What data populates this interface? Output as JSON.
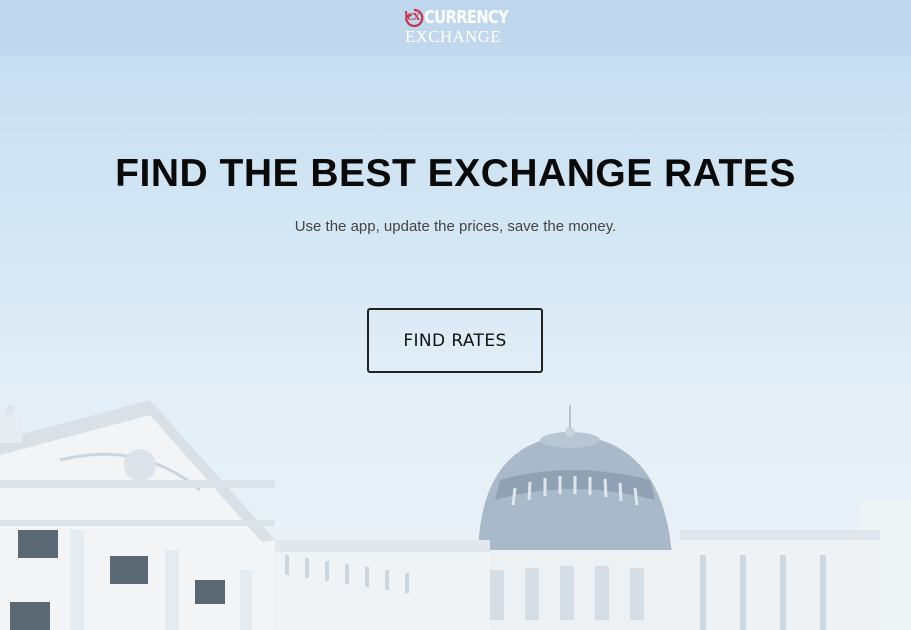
{
  "header": {
    "logo": {
      "mark": "CX",
      "line1": "CURRENCY",
      "line2": "EXCHANGE"
    }
  },
  "hero": {
    "title": "FIND THE BEST EXCHANGE RATES",
    "subtitle": "Use the app, update the prices, save the money.",
    "cta_label": "FIND RATES"
  },
  "colors": {
    "sky": "#c7def0",
    "logo_accent": "#c2364d",
    "title_text": "#0a0a0a",
    "button_border": "#222222"
  },
  "icons": {
    "logo_mark": "currency-exchange-logo-icon"
  }
}
